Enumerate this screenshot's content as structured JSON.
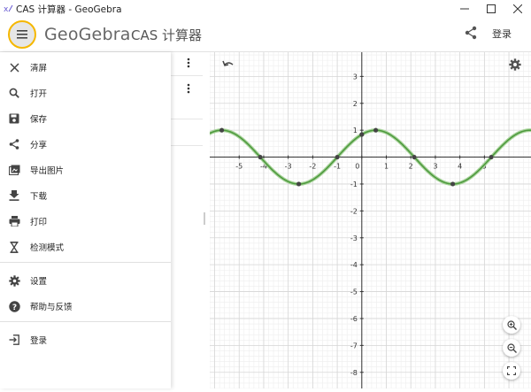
{
  "window": {
    "title": "CAS 计算器 - GeoGebra"
  },
  "header": {
    "logo": "GeoGebra",
    "app_title": "CAS 计算器",
    "login_label": "登录"
  },
  "menu": {
    "items": [
      {
        "label": "清屏",
        "icon": "close-icon"
      },
      {
        "label": "打开",
        "icon": "search-icon"
      },
      {
        "label": "保存",
        "icon": "save-icon"
      },
      {
        "label": "分享",
        "icon": "share-icon"
      },
      {
        "label": "导出图片",
        "icon": "image-icon"
      },
      {
        "label": "下载",
        "icon": "download-icon"
      },
      {
        "label": "打印",
        "icon": "print-icon"
      },
      {
        "label": "检测模式",
        "icon": "hourglass-icon"
      },
      {
        "label": "设置",
        "icon": "gear-icon"
      },
      {
        "label": "帮助与反馈",
        "icon": "help-icon"
      },
      {
        "label": "登录",
        "icon": "login-icon"
      }
    ]
  },
  "colors": {
    "accent": "#f5b700",
    "curve": "#4f9a3f",
    "point": "#444444"
  },
  "chart_data": {
    "type": "line",
    "function": "sin(x + 1)",
    "xlim": [
      -6.2,
      6.9
    ],
    "ylim": [
      -8.6,
      3.9
    ],
    "x_ticks": [
      "-5",
      "-4",
      "-3",
      "-2",
      "-1",
      "0",
      "1",
      "2",
      "3",
      "4",
      "5"
    ],
    "y_ticks": [
      "3",
      "2",
      "1",
      "-1",
      "-2",
      "-3",
      "-4",
      "-5",
      "-6",
      "-7",
      "-8"
    ],
    "grid": true,
    "points": [
      {
        "x": -5.71,
        "y": 1
      },
      {
        "x": -4.14,
        "y": 0
      },
      {
        "x": -2.57,
        "y": -1
      },
      {
        "x": -1,
        "y": 0
      },
      {
        "x": 0,
        "y": 0.84
      },
      {
        "x": 0.57,
        "y": 1
      },
      {
        "x": 2.14,
        "y": 0
      },
      {
        "x": 3.71,
        "y": -1
      },
      {
        "x": 5.28,
        "y": 0
      }
    ]
  }
}
